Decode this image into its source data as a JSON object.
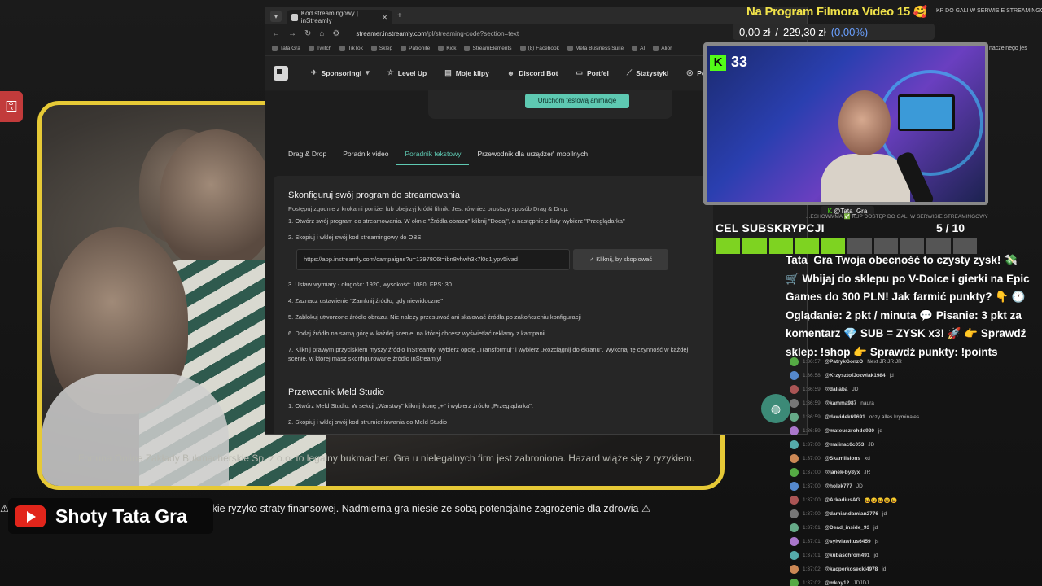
{
  "browser": {
    "tab_title": "Kod streamingowy | inStreamly",
    "new_tab": "+",
    "url_domain": "streamer.instreamly.com",
    "url_path": "/pl/streaming-code?section=text",
    "bookmarks": [
      "Tata Gra",
      "Twitch",
      "TikTok",
      "Sklep",
      "Patronite",
      "Kick",
      "StreamElements",
      "(8) Facebook",
      "Meta Business Suite",
      "AI",
      "Alior"
    ]
  },
  "site": {
    "nav": [
      "Sponsoringi",
      "Level Up",
      "Moje klipy",
      "Discord Bot",
      "Portfel",
      "Statystyki",
      "Pomo"
    ],
    "test_button": "Uruchom testową animacje",
    "subtabs": [
      "Drag & Drop",
      "Poradnik video",
      "Poradnik tekstowy",
      "Przewodnik dla urządzeń mobilnych"
    ],
    "active_subtab": "Poradnik tekstowy",
    "guide_title": "Skonfiguruj swój program do streamowania",
    "guide_intro": "Postępuj zgodnie z krokami poniżej lub obejrzyj krótki filmik. Jest również prostszy sposób Drag & Drop.",
    "steps": [
      "1. Otwórz swój program do streamowania. W oknie \"Źródła obrazu\" kliknij \"Dodaj\", a następnie z listy wybierz \"Przeglądarka\"",
      "2. Skopiuj i wklej swój kod streamingowy do OBS",
      "3. Ustaw wymiary - długość: 1920, wysokość: 1080, FPS: 30",
      "4. Zaznacz ustawienie \"Zamknij źródło, gdy niewidoczne\"",
      "5. Zablokuj utworzone źródło obrazu. Nie należy przesuwać ani skalować źródła po zakończeniu konfiguracji",
      "6. Dodaj źródło na samą górę w każdej scenie, na której chcesz wyświetlać reklamy z kampanii.",
      "7. Kliknij prawym przyciskiem myszy źródło inStreamly, wybierz opcję „Transformuj\" i wybierz „Rozciągnij do ekranu\". Wykonaj tę czynność w każdej scenie, w której masz skonfigurowane źródło inStreamly!"
    ],
    "code_value": "https://app.instreamly.com/campaigns?u=1397806t=ibn8vhwh3k7l0q1jypv5ivad",
    "copy_button": "Kliknij, by skopiować",
    "meld_title": "Przewodnik Meld Studio",
    "meld_steps": [
      "1. Otwórz Meld Studio. W sekcji „Warstwy\" kliknij ikonę „+\" i wybierz źródło „Przeglądarka\".",
      "2. Skopiuj i wklej swój kod strumieniowania do Meld Studio"
    ]
  },
  "video": {
    "disclaimer": "Fortuna Online Zakłady Bukmacherskie Sp. z o.o. to legalny bukmacher. Gra u nielegalnych firm jest zabroniona. Hazard wiąże się z ryzykiem.",
    "warning": "⚠ ...oniżej 18 roku życia. Hazard stwarza wysokie ryzyko straty finansowej. Nadmierna gra niesie ze sobą potencjalne zagrożenie dla zdrowia ⚠",
    "channel_name": "Shoty Tata Gra"
  },
  "overlay": {
    "title": "Na Program Filmora Video 15",
    "title_emoji": "🥰",
    "money_current": "0,00 zł",
    "money_sep": "/",
    "money_goal": "229,30 zł",
    "money_pct": "(0,00%)",
    "top_strip": "KP DO GALI W SERWISIE STREAMINGOW",
    "side_strip": "naczelnego  jes",
    "kick_viewers": "33",
    "cam_handle": "@Tata_Gra",
    "goal_label": "CEL SUBSKRYPCJI",
    "goal_count": "5 / 10",
    "goal_filled": 5,
    "goal_total": 10
  },
  "chat": {
    "pinned": "Tata_Gra Twoja obecność to czysty zysk! 💸 🛒 Wbijaj do sklepu po V-Dolce i gierki na Epic Games do 300 PLN! Jak farmić punkty? 👇 🕐 Oglądanie: 2 pkt / minuta 💬 Pisanie: 3 pkt za komentarz 💎 SUB = ZYSK x3! 🚀 👉 Sprawdź sklep: !shop 👉 Sprawdź punkty: !points",
    "pre": "...ESHOWMMA ✅ KUP DOSTĘP DO GALI W SERWISIE STREAMINGOWY",
    "rows": [
      {
        "time": "1:36:57",
        "user": "@PatrykGonzO",
        "msg": "Next JR JR JR"
      },
      {
        "time": "1:36:58",
        "user": "@KrzysztofJozwiak1984",
        "msg": "jd"
      },
      {
        "time": "1:36:59",
        "user": "@daliaba",
        "msg": "JD"
      },
      {
        "time": "1:36:59",
        "user": "@kamma987",
        "msg": "naura"
      },
      {
        "time": "1:36:59",
        "user": "@dawidek69691",
        "msg": "oczy alles kryminales"
      },
      {
        "time": "1:36:59",
        "user": "@mateuszrohde920",
        "msg": "jd"
      },
      {
        "time": "1:37:00",
        "user": "@malinac0c053",
        "msg": "JD"
      },
      {
        "time": "1:37:00",
        "user": "@Skamilsions",
        "msg": "xd"
      },
      {
        "time": "1:37:00",
        "user": "@janek-by8yx",
        "msg": "JR"
      },
      {
        "time": "1:37:00",
        "user": "@holek777",
        "msg": "JD"
      },
      {
        "time": "1:37:00",
        "user": "@ArkadiusAG",
        "msg": "😆😆😆😆😆"
      },
      {
        "time": "1:37:00",
        "user": "@damiandamian2776",
        "msg": "jd"
      },
      {
        "time": "1:37:01",
        "user": "@Dead_inside_93",
        "msg": "jd"
      },
      {
        "time": "1:37:01",
        "user": "@sylwiawitus6459",
        "msg": "js"
      },
      {
        "time": "1:37:01",
        "user": "@kubaschrom491",
        "msg": "jd"
      },
      {
        "time": "1:37:02",
        "user": "@kacperkosecki4978",
        "msg": "jd"
      },
      {
        "time": "1:37:02",
        "user": "@mkoy12",
        "msg": "JDJDJ"
      }
    ]
  },
  "colors": {
    "accent": "#5ec9b2",
    "frame": "#e6c936",
    "goal": "#7ed321",
    "kick": "#53fc18"
  }
}
